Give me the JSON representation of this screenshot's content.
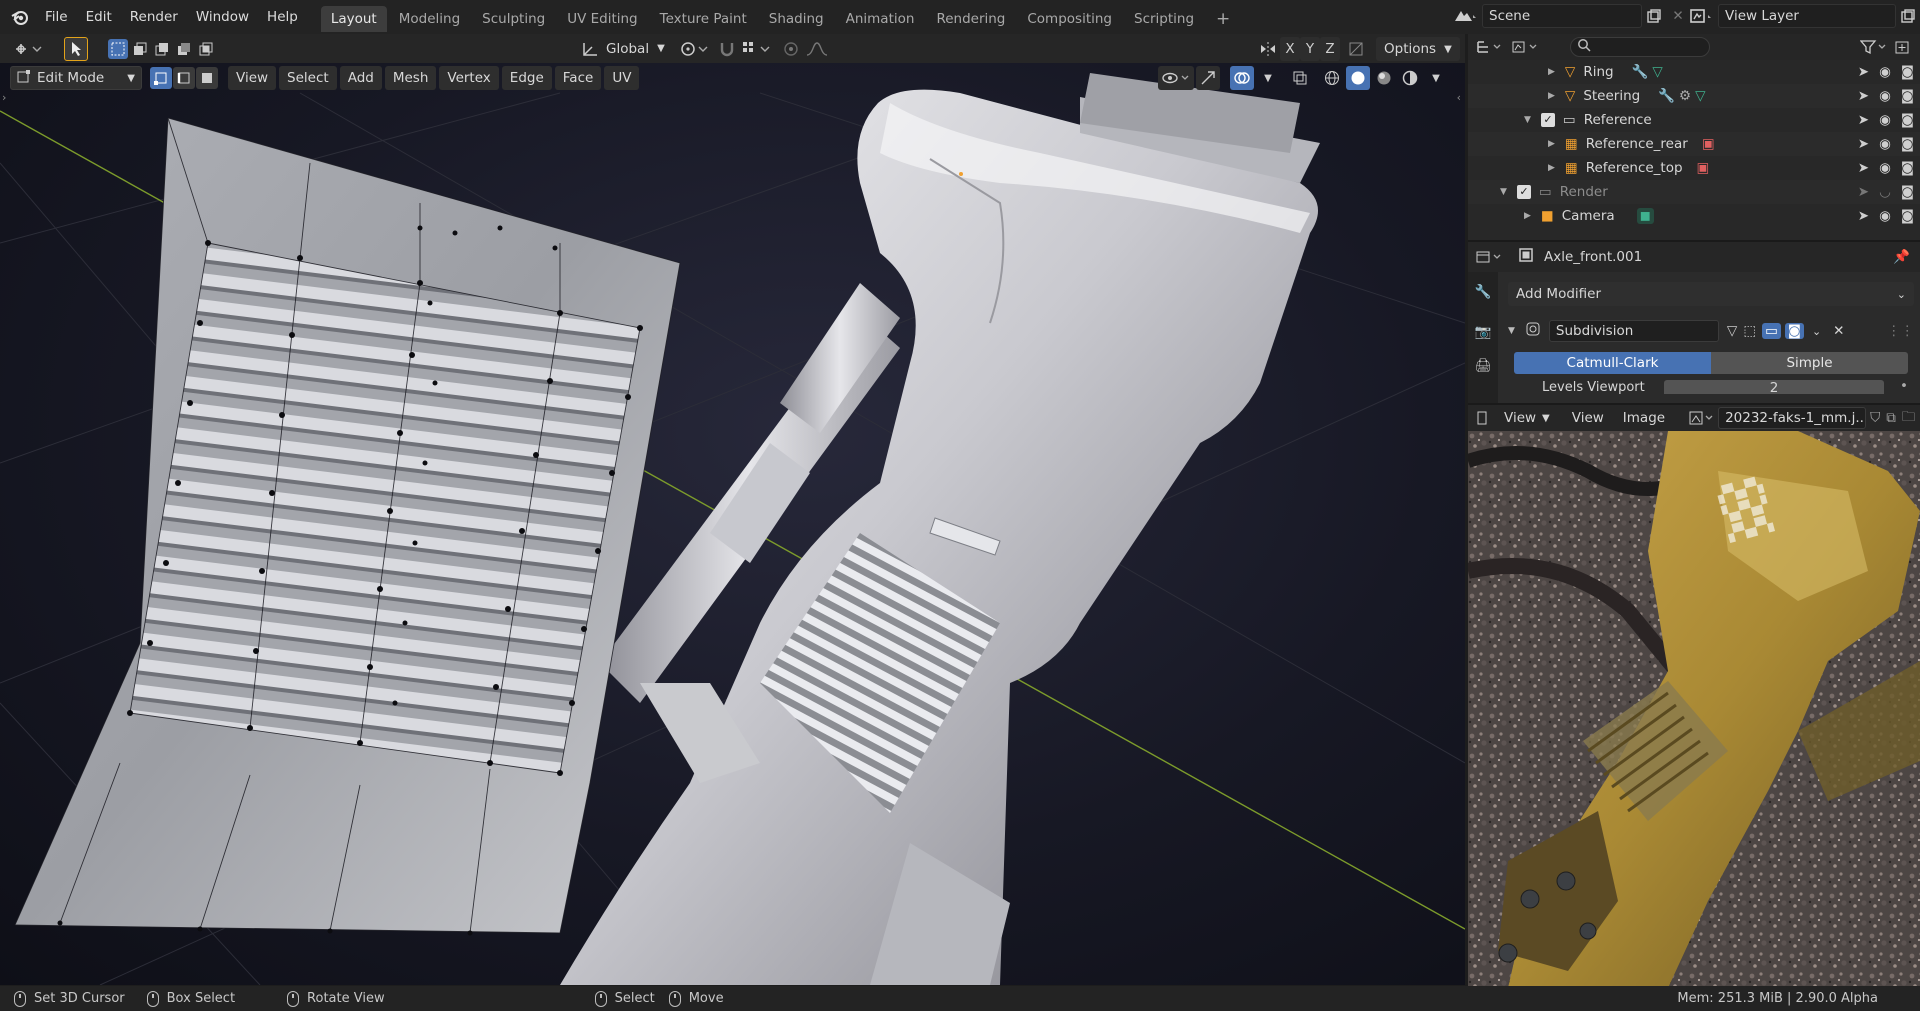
{
  "topbar": {
    "menus": [
      "File",
      "Edit",
      "Render",
      "Window",
      "Help"
    ],
    "workspaces": [
      "Layout",
      "Modeling",
      "Sculpting",
      "UV Editing",
      "Texture Paint",
      "Shading",
      "Animation",
      "Rendering",
      "Compositing",
      "Scripting"
    ],
    "active_workspace": "Layout",
    "add_tab": "+",
    "scene": "Scene",
    "view_layer": "View Layer"
  },
  "tool_header": {
    "orientation": "Global",
    "options": "Options",
    "axes": [
      "X",
      "Y",
      "Z"
    ]
  },
  "viewport_header": {
    "mode": "Edit Mode",
    "menus": [
      "View",
      "Select",
      "Add",
      "Mesh",
      "Vertex",
      "Edge",
      "Face",
      "UV"
    ]
  },
  "outliner": {
    "search_placeholder": "",
    "rows": [
      {
        "label": "Ring",
        "indent": 3,
        "icon": "modifier-icon"
      },
      {
        "label": "Steering",
        "indent": 3,
        "icon": "modifier-icon"
      },
      {
        "label": "Reference",
        "indent": 2,
        "icon": "collection-icon",
        "checked": true
      },
      {
        "label": "Reference_rear",
        "indent": 3,
        "icon": "image-empty-icon"
      },
      {
        "label": "Reference_top",
        "indent": 3,
        "icon": "image-empty-icon"
      },
      {
        "label": "Render",
        "indent": 1,
        "icon": "collection-icon",
        "checked": true,
        "dim": true
      },
      {
        "label": "Camera",
        "indent": 2,
        "icon": "camera-icon"
      }
    ]
  },
  "properties": {
    "object_name": "Axle_front.001",
    "add_modifier": "Add Modifier",
    "modifier_name": "Subdivision",
    "method_a": "Catmull-Clark",
    "method_b": "Simple",
    "levels_label": "Levels Viewport",
    "levels_value": "2"
  },
  "image_editor": {
    "mode": "View",
    "menus": [
      "View",
      "Image"
    ],
    "image_name": "20232-faks-1_mm.j..."
  },
  "statusbar": {
    "items": [
      "Set 3D Cursor",
      "Box Select",
      "Rotate View",
      "Select",
      "Move"
    ],
    "memory": "Mem: 251.3 MiB | 2.90.0 Alpha"
  },
  "colors": {
    "accent": "#4772b3",
    "active_blue": "#4a7ed0",
    "grid_line": "#7c9b2b"
  }
}
